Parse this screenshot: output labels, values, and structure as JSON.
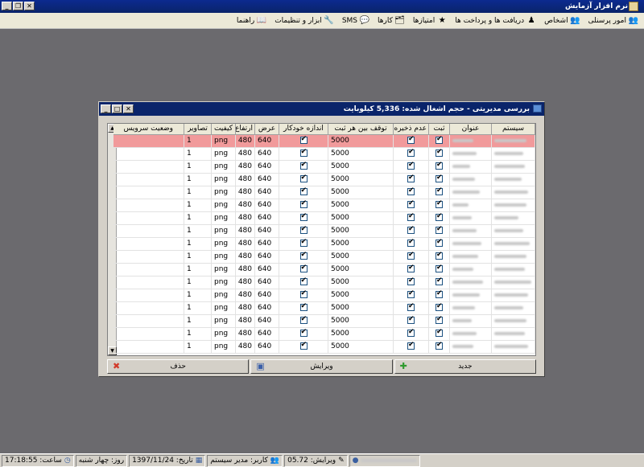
{
  "app": {
    "title": "نرم افزار آزمایش"
  },
  "menu": [
    {
      "icon": "people-icon",
      "glyph": "👥",
      "label": "امور پرسنلی"
    },
    {
      "icon": "persons-icon",
      "glyph": "👥",
      "label": "اشخاص"
    },
    {
      "icon": "payment-icon",
      "glyph": "♟",
      "label": "دریافت ها و پرداخت ها"
    },
    {
      "icon": "star-icon",
      "glyph": "★",
      "label": "امتیازها"
    },
    {
      "icon": "cards-icon",
      "glyph": "🗂",
      "label": "کارها"
    },
    {
      "icon": "sms-icon",
      "glyph": "💬",
      "label": "SMS"
    },
    {
      "icon": "tools-icon",
      "glyph": "🔧",
      "label": "ابزار و تنظیمات"
    },
    {
      "icon": "help-icon",
      "glyph": "📖",
      "label": "راهنما"
    }
  ],
  "dialog": {
    "title": "بررسی مدیریتی - حجم اشغال شده: 5,336 کیلوبایت"
  },
  "grid": {
    "columns": [
      "سیستم",
      "عنوان",
      "ثبت",
      "عدم ذخیره",
      "توقف بین هر ثبت",
      "اندازه خودکار",
      "عرض",
      "ارتفاع",
      "کیفیت",
      "تصاویر",
      "وضعیت سرویس"
    ],
    "rows": [
      {
        "pause": "5000",
        "width": "640",
        "height": "480",
        "quality": "png",
        "images": "1"
      },
      {
        "pause": "5000",
        "width": "640",
        "height": "480",
        "quality": "png",
        "images": "1"
      },
      {
        "pause": "5000",
        "width": "640",
        "height": "480",
        "quality": "png",
        "images": "1"
      },
      {
        "pause": "5000",
        "width": "640",
        "height": "480",
        "quality": "png",
        "images": "1"
      },
      {
        "pause": "5000",
        "width": "640",
        "height": "480",
        "quality": "png",
        "images": "1"
      },
      {
        "pause": "5000",
        "width": "640",
        "height": "480",
        "quality": "png",
        "images": "1"
      },
      {
        "pause": "5000",
        "width": "640",
        "height": "480",
        "quality": "png",
        "images": "1"
      },
      {
        "pause": "5000",
        "width": "640",
        "height": "480",
        "quality": "png",
        "images": "1"
      },
      {
        "pause": "5000",
        "width": "640",
        "height": "480",
        "quality": "png",
        "images": "1"
      },
      {
        "pause": "5000",
        "width": "640",
        "height": "480",
        "quality": "png",
        "images": "1"
      },
      {
        "pause": "5000",
        "width": "640",
        "height": "480",
        "quality": "png",
        "images": "1"
      },
      {
        "pause": "5000",
        "width": "640",
        "height": "480",
        "quality": "png",
        "images": "1"
      },
      {
        "pause": "5000",
        "width": "640",
        "height": "480",
        "quality": "png",
        "images": "1"
      },
      {
        "pause": "5000",
        "width": "640",
        "height": "480",
        "quality": "png",
        "images": "1"
      },
      {
        "pause": "5000",
        "width": "640",
        "height": "480",
        "quality": "png",
        "images": "1"
      },
      {
        "pause": "5000",
        "width": "640",
        "height": "480",
        "quality": "png",
        "images": "1"
      },
      {
        "pause": "5000",
        "width": "640",
        "height": "480",
        "quality": "png",
        "images": "1"
      }
    ],
    "selected_color": "#f19a9b"
  },
  "buttons": {
    "new_label": "جدید",
    "edit_label": "ویرایش",
    "delete_label": "حذف"
  },
  "status": {
    "version": "ویرایش: 05.72",
    "user": "کاربر: مدیر سیستم",
    "date": "تاریخ: 1397/11/24",
    "day": "روز: چهار شنبه",
    "time": "ساعت: 17:18:55"
  }
}
